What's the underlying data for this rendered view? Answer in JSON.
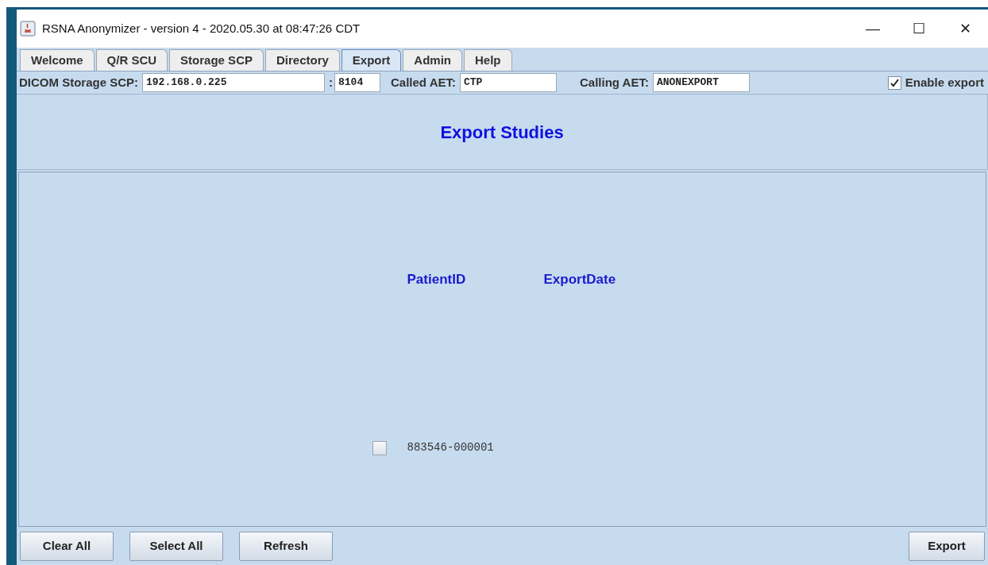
{
  "window": {
    "title": "RSNA Anonymizer - version 4 - 2020.05.30 at 08:47:26 CDT",
    "controls": [
      "—",
      "☐",
      "✕"
    ]
  },
  "tabs": [
    {
      "label": "Welcome",
      "selected": false
    },
    {
      "label": "Q/R SCU",
      "selected": false
    },
    {
      "label": "Storage SCP",
      "selected": false
    },
    {
      "label": "Directory",
      "selected": false
    },
    {
      "label": "Export",
      "selected": true
    },
    {
      "label": "Admin",
      "selected": false
    },
    {
      "label": "Help",
      "selected": false
    }
  ],
  "toolbar": {
    "scp_label": "DICOM Storage SCP:",
    "ip": "192.168.0.225",
    "port_separator": ":",
    "port": "8104",
    "called_label": "Called AET:",
    "called": "CTP",
    "calling_label": "Calling AET:",
    "calling": "ANONEXPORT",
    "enable_label": "Enable export",
    "enable_checked": true
  },
  "heading": "Export Studies",
  "table": {
    "columns": [
      "PatientID",
      "ExportDate"
    ],
    "rows": [
      {
        "checked": false,
        "patient_id": "883546-000001"
      }
    ]
  },
  "buttons_left": [
    "Clear All",
    "Select All",
    "Refresh"
  ],
  "button_right": "Export"
}
